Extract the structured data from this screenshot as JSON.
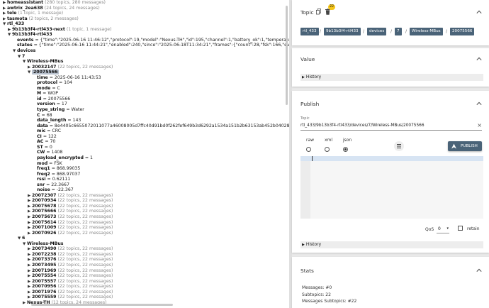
{
  "tree": {
    "lines": [
      {
        "toggle": "▶",
        "name": "homeassistant",
        "meta": "(280 topics, 280 messages)",
        "value": "",
        "bold": true,
        "selected": false
      },
      {
        "toggle": "▶",
        "name": "awtrix_2ea638",
        "meta": "(24 topics, 24 messages)",
        "value": "",
        "bold": true,
        "selected": false
      },
      {
        "toggle": "▶",
        "name": "tele",
        "meta": "(1 topic, 1 message)",
        "value": "",
        "bold": true,
        "selected": false
      },
      {
        "toggle": "▶",
        "name": "tasmota",
        "meta": "(2 topics, 2 messages)",
        "value": "",
        "bold": true,
        "selected": false
      },
      {
        "toggle": "▼",
        "name": "rtl_433",
        "meta": "",
        "value": "",
        "bold": true,
        "selected": false
      },
      {
        "toggle": "▶",
        "name": "9b13b3f4-rtl433-next",
        "meta": "(1 topic, 1 message)",
        "value": "",
        "bold": true,
        "selected": false
      },
      {
        "toggle": "▼",
        "name": "9b13b3f4-rtl433",
        "meta": "",
        "value": "",
        "bold": true,
        "selected": false
      },
      {
        "toggle": "",
        "name": "events",
        "meta": "",
        "value": "= {\"time\":\"2025-06-16 11:46:12\",\"protocol\":19,\"model\":\"Nexus-TH\",\"id\":195,\"channel\":1,\"battery_ok\":1,\"temperature_C\":21.1,\"humidity\":78,\"m",
        "bold": true,
        "selected": false
      },
      {
        "toggle": "",
        "name": "states",
        "meta": "",
        "value": "= {\"time\":\"2025-06-16 11:44:21\",\"enabled\":240,\"since\":\"2025-06-18T11:34:21\",\"frames\":{\"count\":28,\"fsk\":166,\"events\":118},\"stats\":[{\"device\":1",
        "bold": true,
        "selected": false
      },
      {
        "toggle": "▼",
        "name": "devices",
        "meta": "",
        "value": "",
        "bold": true,
        "selected": false
      },
      {
        "toggle": "▼",
        "name": "7",
        "meta": "",
        "value": "",
        "bold": true,
        "selected": false
      },
      {
        "toggle": "▼",
        "name": "Wireless-MBus",
        "meta": "",
        "value": "",
        "bold": true,
        "selected": false
      },
      {
        "toggle": "▶",
        "name": "20032147",
        "meta": "(22 topics, 22 messages)",
        "value": "",
        "bold": true,
        "selected": false
      },
      {
        "toggle": "▼",
        "name": "20075566",
        "meta": "",
        "value": "",
        "bold": true,
        "selected": true
      },
      {
        "toggle": "",
        "name": "time",
        "meta": "",
        "value": "= 2025-06-16 11:43:53",
        "bold": true,
        "selected": false
      },
      {
        "toggle": "",
        "name": "protocol",
        "meta": "",
        "value": "= 104",
        "bold": true,
        "selected": false
      },
      {
        "toggle": "",
        "name": "mode",
        "meta": "",
        "value": "= C",
        "bold": true,
        "selected": false
      },
      {
        "toggle": "",
        "name": "M",
        "meta": "",
        "value": "= WGP",
        "bold": true,
        "selected": false
      },
      {
        "toggle": "",
        "name": "id",
        "meta": "",
        "value": "= 20075566",
        "bold": true,
        "selected": false
      },
      {
        "toggle": "",
        "name": "version",
        "meta": "",
        "value": "= 17",
        "bold": true,
        "selected": false
      },
      {
        "toggle": "",
        "name": "type_string",
        "meta": "",
        "value": "= Water",
        "bold": true,
        "selected": false
      },
      {
        "toggle": "",
        "name": "C",
        "meta": "",
        "value": "= 68",
        "bold": true,
        "selected": false
      },
      {
        "toggle": "",
        "name": "data_length",
        "meta": "",
        "value": "= 143",
        "bold": true,
        "selected": false
      },
      {
        "toggle": "",
        "name": "data",
        "meta": "",
        "value": "= 8e4405c6655072011077a46008005d7ffc40d91bd0f262fef649b3d6292a1534a151b2b63153ab452b04028 5b8bec15cf1d316699e262",
        "bold": true,
        "selected": false
      },
      {
        "toggle": "",
        "name": "mic",
        "meta": "",
        "value": "= CRC",
        "bold": true,
        "selected": false
      },
      {
        "toggle": "",
        "name": "CI",
        "meta": "",
        "value": "= 122",
        "bold": true,
        "selected": false
      },
      {
        "toggle": "",
        "name": "AC",
        "meta": "",
        "value": "= 70",
        "bold": true,
        "selected": false
      },
      {
        "toggle": "",
        "name": "ST",
        "meta": "",
        "value": "= 0",
        "bold": true,
        "selected": false
      },
      {
        "toggle": "",
        "name": "CW",
        "meta": "",
        "value": "= 1408",
        "bold": true,
        "selected": false
      },
      {
        "toggle": "",
        "name": "payload_encrypted",
        "meta": "",
        "value": "= 1",
        "bold": true,
        "selected": false
      },
      {
        "toggle": "",
        "name": "mod",
        "meta": "",
        "value": "= FSK",
        "bold": true,
        "selected": false
      },
      {
        "toggle": "",
        "name": "freq1",
        "meta": "",
        "value": "= 868.99035",
        "bold": true,
        "selected": false
      },
      {
        "toggle": "",
        "name": "freq2",
        "meta": "",
        "value": "= 868.97037",
        "bold": true,
        "selected": false
      },
      {
        "toggle": "",
        "name": "rssi",
        "meta": "",
        "value": "= 0.62111",
        "bold": true,
        "selected": false
      },
      {
        "toggle": "",
        "name": "snr",
        "meta": "",
        "value": "= 22.3667",
        "bold": true,
        "selected": false
      },
      {
        "toggle": "",
        "name": "noise",
        "meta": "",
        "value": "= -22.367",
        "bold": true,
        "selected": false
      },
      {
        "toggle": "▶",
        "name": "20072307",
        "meta": "(22 topics, 22 messages)",
        "value": "",
        "bold": true,
        "selected": false
      },
      {
        "toggle": "▶",
        "name": "20070934",
        "meta": "(22 topics, 22 messages)",
        "value": "",
        "bold": true,
        "selected": false
      },
      {
        "toggle": "▶",
        "name": "20075678",
        "meta": "(22 topics, 22 messages)",
        "value": "",
        "bold": true,
        "selected": false
      },
      {
        "toggle": "▶",
        "name": "20075666",
        "meta": "(22 topics, 22 messages)",
        "value": "",
        "bold": true,
        "selected": false
      },
      {
        "toggle": "▶",
        "name": "20075673",
        "meta": "(22 topics, 22 messages)",
        "value": "",
        "bold": true,
        "selected": false
      },
      {
        "toggle": "▶",
        "name": "20075614",
        "meta": "(22 topics, 22 messages)",
        "value": "",
        "bold": true,
        "selected": false
      },
      {
        "toggle": "▶",
        "name": "20071009",
        "meta": "(22 topics, 22 messages)",
        "value": "",
        "bold": true,
        "selected": false
      },
      {
        "toggle": "▶",
        "name": "20070926",
        "meta": "(22 topics, 22 messages)",
        "value": "",
        "bold": true,
        "selected": false
      },
      {
        "toggle": "▼",
        "name": "6",
        "meta": "",
        "value": "",
        "bold": true,
        "selected": false
      },
      {
        "toggle": "▼",
        "name": "Wireless-MBus",
        "meta": "",
        "value": "",
        "bold": true,
        "selected": false
      },
      {
        "toggle": "▶",
        "name": "20073490",
        "meta": "(22 topics, 22 messages)",
        "value": "",
        "bold": true,
        "selected": false
      },
      {
        "toggle": "▶",
        "name": "20072238",
        "meta": "(22 topics, 22 messages)",
        "value": "",
        "bold": true,
        "selected": false
      },
      {
        "toggle": "▶",
        "name": "20073376",
        "meta": "(22 topics, 22 messages)",
        "value": "",
        "bold": true,
        "selected": false
      },
      {
        "toggle": "▶",
        "name": "20073495",
        "meta": "(22 topics, 22 messages)",
        "value": "",
        "bold": true,
        "selected": false
      },
      {
        "toggle": "▶",
        "name": "20071969",
        "meta": "(22 topics, 22 messages)",
        "value": "",
        "bold": true,
        "selected": false
      },
      {
        "toggle": "▶",
        "name": "20075554",
        "meta": "(22 topics, 22 messages)",
        "value": "",
        "bold": true,
        "selected": false
      },
      {
        "toggle": "▶",
        "name": "20075557",
        "meta": "(22 topics, 22 messages)",
        "value": "",
        "bold": true,
        "selected": false
      },
      {
        "toggle": "▶",
        "name": "20070956",
        "meta": "(22 topics, 22 messages)",
        "value": "",
        "bold": true,
        "selected": false
      },
      {
        "toggle": "▶",
        "name": "20071976",
        "meta": "(22 topics, 22 messages)",
        "value": "",
        "bold": true,
        "selected": false
      },
      {
        "toggle": "▶",
        "name": "20075559",
        "meta": "(22 topics, 22 messages)",
        "value": "",
        "bold": true,
        "selected": false
      },
      {
        "toggle": "▶",
        "name": "Nexus-TH",
        "meta": "(12 topics, 24 messages)",
        "value": "",
        "bold": true,
        "selected": false
      }
    ],
    "indents": [
      0,
      0,
      0,
      0,
      0,
      1,
      1,
      2,
      2,
      2,
      3,
      4,
      5,
      5,
      6,
      6,
      6,
      6,
      6,
      6,
      6,
      6,
      6,
      6,
      6,
      6,
      6,
      6,
      6,
      6,
      6,
      6,
      6,
      6,
      6,
      6,
      5,
      5,
      5,
      5,
      5,
      5,
      5,
      5,
      3,
      4,
      5,
      5,
      5,
      5,
      5,
      5,
      5,
      5,
      5,
      5,
      4
    ]
  },
  "topic_panel": {
    "title": "Topic",
    "copy_icon": "copy-icon",
    "delete_icon": "trash-icon",
    "badge": "22",
    "path": [
      "rtl_433",
      "9b13b3f4-rtl433",
      "devices",
      "7",
      "Wireless-MBus",
      "20075566"
    ],
    "separator": "/"
  },
  "value_panel": {
    "title": "Value",
    "history_label": "History"
  },
  "publish_panel": {
    "title": "Publish",
    "topic_label": "Topic",
    "topic_value": "rtl_433/9b13b3f4-rtl433/devices/7/Wireless-MBus/20075566",
    "clear_icon": "×",
    "formats": [
      {
        "label": "raw",
        "checked": false
      },
      {
        "label": "xml",
        "checked": false
      },
      {
        "label": "json",
        "checked": true
      }
    ],
    "publish_label": "PUBLISH",
    "qos_label": "QoS",
    "qos_value": "0",
    "retain_label": "retain",
    "retain_checked": false,
    "history_label": "History"
  },
  "stats_panel": {
    "title": "Stats",
    "lines": [
      "Messages: #0",
      "Subtopics: 22",
      "Messages Subtopics: #22"
    ]
  },
  "colors": {
    "accent": "#4a6378",
    "badge": "#f5c518",
    "selection": "#b7c0cd"
  }
}
